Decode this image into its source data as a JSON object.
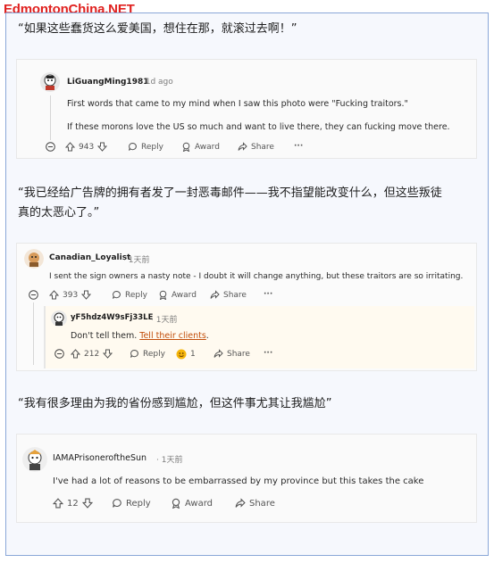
{
  "site_logo": "EdmontonChina.NET",
  "sections": [
    {
      "quote": "“如果这些蠢货这么爱美国，想住在那，就滚过去啊！”",
      "comment": {
        "username": "LiGuangMing1981",
        "time": "1d ago",
        "lines": [
          "First words that came to my mind when I saw this photo were \"Fucking traitors.\"",
          "If these morons love the US so much and want to live there, they can fucking move there."
        ],
        "votes": "943",
        "reply": "Reply",
        "award": "Award",
        "share": "Share",
        "more": "···"
      }
    },
    {
      "quote_line1": "“我已经给广告牌的拥有者发了一封恶毒邮件——我不指望能改变什么，但这些叛徒",
      "quote_line2": "真的太恶心了。”",
      "comment": {
        "username": "Canadian_Loyalist",
        "time": "1天前",
        "text": "I sent the sign owners a nasty note - I doubt it will change anything, but these traitors are so irritating.",
        "votes": "393",
        "reply": "Reply",
        "award": "Award",
        "share": "Share",
        "more": "···"
      },
      "reply_comment": {
        "username": "yF5hdz4W9sFj33LE",
        "time": "1天前",
        "text_prefix": "Don't tell them. ",
        "text_link": "Tell their clients",
        "text_suffix": ".",
        "votes": "212",
        "reply": "Reply",
        "award_count": "1",
        "share": "Share",
        "more": "···"
      }
    },
    {
      "quote": "“我有很多理由为我的省份感到尴尬，但这件事尤其让我尴尬”",
      "comment": {
        "username": "IAMAPrisoneroftheSun",
        "time": "1天前",
        "text": "I've had a lot of reasons to be embarrassed by my province but this takes the cake",
        "votes": "12",
        "reply": "Reply",
        "award": "Award",
        "share": "Share"
      }
    }
  ]
}
